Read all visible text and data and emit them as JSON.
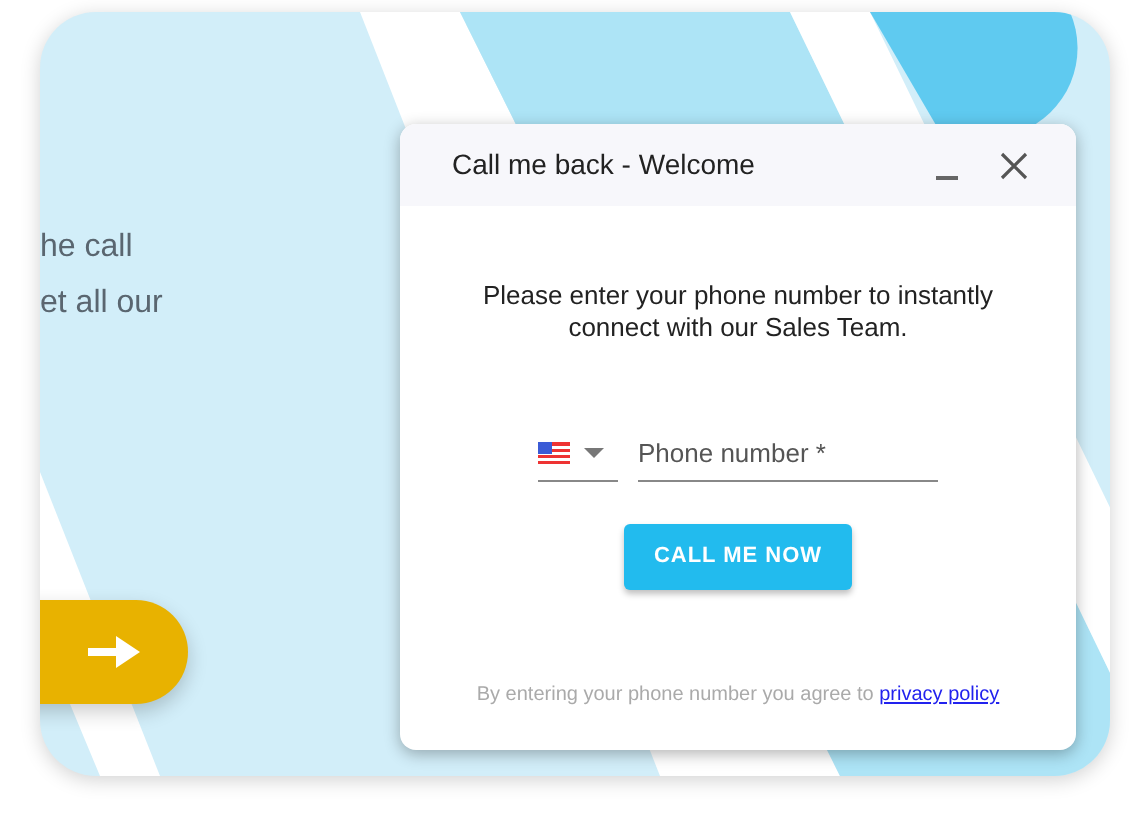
{
  "page": {
    "text_lines": [
      "he call",
      "et all our"
    ]
  },
  "dialog": {
    "title": "Call me back - Welcome",
    "message": "Please enter your phone number to instantly connect with our Sales Team.",
    "phone": {
      "placeholder": "Phone number *"
    },
    "submit": "CALL ME NOW",
    "consent": "By entering your phone number you agree to",
    "consent_link": "privacy policy"
  }
}
